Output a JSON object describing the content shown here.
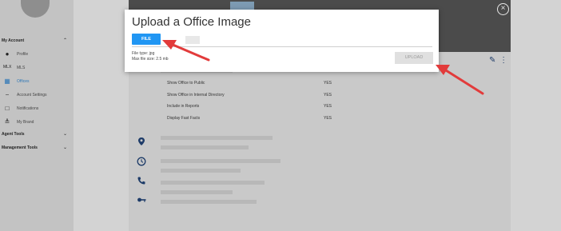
{
  "sidebar": {
    "my_account": "My Account",
    "items": [
      {
        "label": "Profile",
        "icon": "person-icon",
        "active": false
      },
      {
        "label": "MLS",
        "icon": "mls-icon",
        "active": false
      },
      {
        "label": "Offices",
        "icon": "offices-icon",
        "active": true
      },
      {
        "label": "Account Settings",
        "icon": "key-icon",
        "active": false
      },
      {
        "label": "Notifications",
        "icon": "chat-bubble-icon",
        "active": false
      },
      {
        "label": "My Brand",
        "icon": "chart-icon",
        "active": false
      }
    ],
    "agent_tools": "Agent Tools",
    "management_tools": "Management Tools",
    "mls_icon_text": "MLX"
  },
  "settings": [
    {
      "label": "Show Office to Public",
      "value": "YES"
    },
    {
      "label": "Show Office in Internal Directory",
      "value": "YES"
    },
    {
      "label": "Include in Reports",
      "value": "YES"
    },
    {
      "label": "Display Fast Facts",
      "value": "YES"
    }
  ],
  "modal": {
    "title": "Upload a Office Image",
    "file_button": "FILE",
    "file_type": "File type: jpg",
    "max_size": "Max file size: 2.5 mb",
    "upload_button": "UPLOAD"
  },
  "colors": {
    "accent": "#2196f3",
    "annotation_arrow": "#e23b3b",
    "link_active": "#2f78b7"
  }
}
